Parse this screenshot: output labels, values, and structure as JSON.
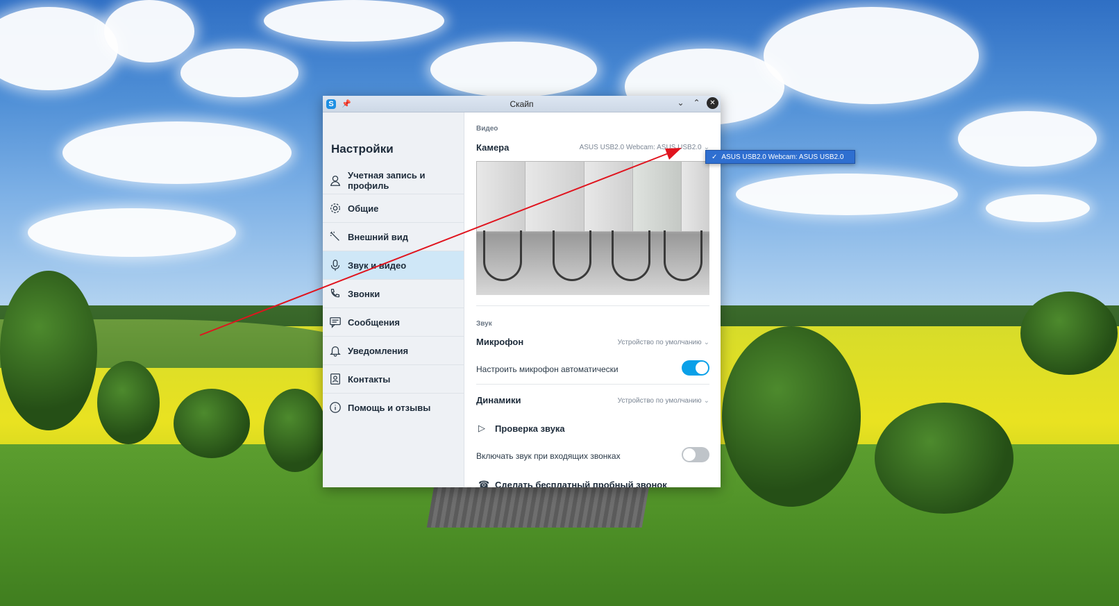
{
  "window": {
    "title": "Скайп",
    "icons": {
      "app": "skype-icon",
      "pin": "pin-icon",
      "minimize": "chevron-down-icon",
      "maximize": "chevron-up-icon",
      "close": "close-icon"
    },
    "app_icon_letter": "S"
  },
  "sidebar": {
    "heading": "Настройки",
    "active_index": 3,
    "items": [
      {
        "label": "Учетная запись и профиль",
        "icon": "person-icon"
      },
      {
        "label": "Общие",
        "icon": "gear-icon"
      },
      {
        "label": "Внешний вид",
        "icon": "magic-wand-icon"
      },
      {
        "label": "Звук и видео",
        "icon": "microphone-icon"
      },
      {
        "label": "Звонки",
        "icon": "phone-icon"
      },
      {
        "label": "Сообщения",
        "icon": "message-icon"
      },
      {
        "label": "Уведомления",
        "icon": "bell-icon"
      },
      {
        "label": "Контакты",
        "icon": "contacts-icon"
      },
      {
        "label": "Помощь и отзывы",
        "icon": "info-icon"
      }
    ]
  },
  "video": {
    "section_label": "Видео",
    "camera_title": "Камера",
    "camera_value": "ASUS USB2.0 Webcam: ASUS USB2.0"
  },
  "audio": {
    "section_label": "Звук",
    "microphone_title": "Микрофон",
    "microphone_value": "Устройство по умолчанию",
    "auto_mic_label": "Настроить микрофон автоматически",
    "auto_mic_enabled": true,
    "speakers_title": "Динамики",
    "speakers_value": "Устройство по умолчанию",
    "sound_test_label": "Проверка звука",
    "ring_label": "Включать звук при входящих звонках",
    "ring_enabled": false,
    "test_call_label": "Сделать бесплатный пробный звонок"
  },
  "dropdown": {
    "options": [
      {
        "label": "ASUS USB2.0 Webcam: ASUS USB2.0",
        "selected": true
      }
    ]
  },
  "colors": {
    "accent": "#0aa0e8",
    "active_nav": "#cfe7f7",
    "dropdown_highlight": "#2f6fd0",
    "annotation_arrow": "#e0141e"
  }
}
